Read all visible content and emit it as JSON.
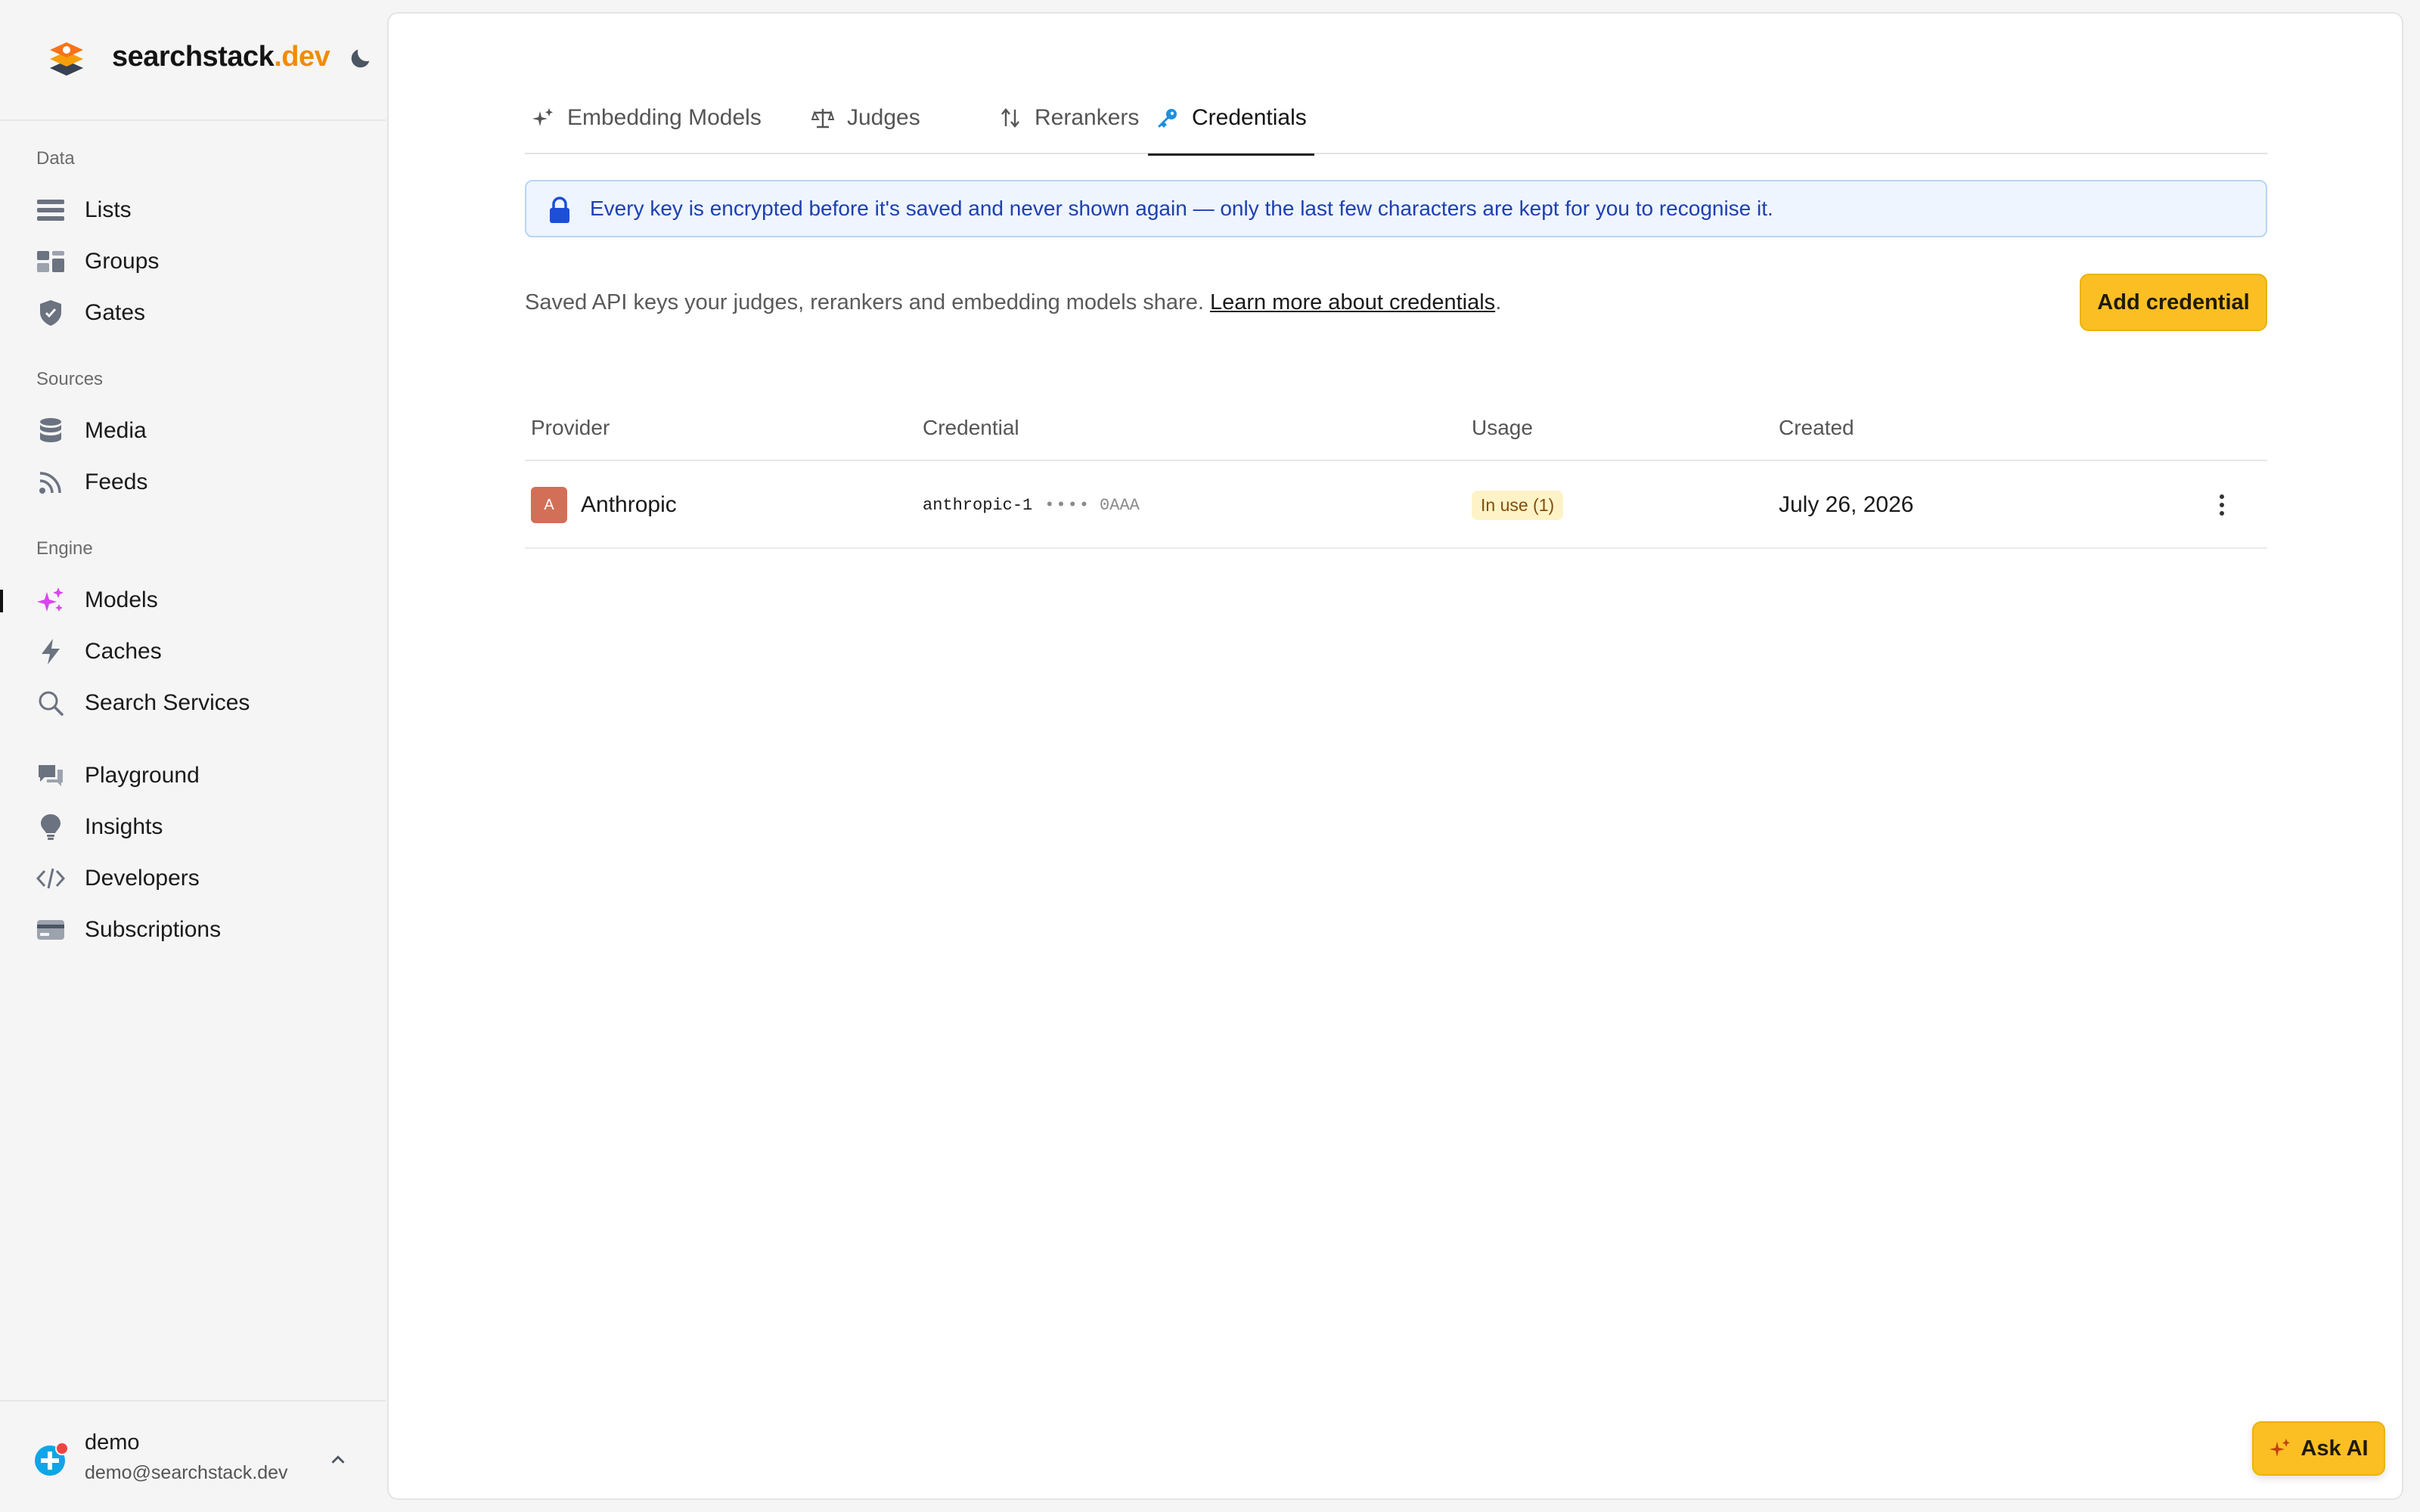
{
  "brand": {
    "name": "searchstack",
    "tld": ".dev"
  },
  "sidebar": {
    "sections": [
      {
        "label": "Data"
      },
      {
        "label": "Sources"
      },
      {
        "label": "Engine"
      }
    ],
    "items": [
      {
        "label": "Lists",
        "icon": "list-icon"
      },
      {
        "label": "Groups",
        "icon": "groups-icon"
      },
      {
        "label": "Gates",
        "icon": "shield-icon"
      },
      {
        "label": "Media",
        "icon": "database-icon"
      },
      {
        "label": "Feeds",
        "icon": "rss-icon"
      },
      {
        "label": "Models",
        "icon": "sparkles-icon",
        "active": true
      },
      {
        "label": "Caches",
        "icon": "lightning-icon"
      },
      {
        "label": "Search Services",
        "icon": "search-icon"
      },
      {
        "label": "Playground",
        "icon": "chat-icon"
      },
      {
        "label": "Insights",
        "icon": "lightbulb-icon"
      },
      {
        "label": "Developers",
        "icon": "code-icon"
      },
      {
        "label": "Subscriptions",
        "icon": "credit-card-icon"
      }
    ],
    "user": {
      "name": "demo",
      "email": "demo@searchstack.dev"
    }
  },
  "tabs": [
    {
      "label": "Embedding Models",
      "icon": "sparkles-icon"
    },
    {
      "label": "Judges",
      "icon": "scale-icon"
    },
    {
      "label": "Rerankers",
      "icon": "arrows-updown-icon"
    },
    {
      "label": "Credentials",
      "icon": "key-icon",
      "active": true
    }
  ],
  "banner": {
    "text": "Every key is encrypted before it's saved and never shown again — only the last few characters are kept for you to recognise it."
  },
  "description": {
    "text": "Saved API keys your judges, rerankers and embedding models share. ",
    "link": "Learn more about credentials",
    "suffix": "."
  },
  "add_button": {
    "label": "Add credential"
  },
  "table": {
    "columns": [
      "Provider",
      "Credential",
      "Usage",
      "Created"
    ],
    "rows": [
      {
        "provider_initial": "A",
        "provider": "Anthropic",
        "credential_name": "anthropic-1",
        "credential_mask": "••••",
        "credential_tail": "0AAA",
        "usage": "In use (1)",
        "created": "July 26, 2026"
      }
    ]
  },
  "ask_ai": {
    "label": "Ask AI"
  },
  "colors": {
    "accent": "#fbbf24",
    "brand_orange": "#f08c00",
    "models_active": "#d946ef",
    "banner_text": "#1e40af"
  }
}
